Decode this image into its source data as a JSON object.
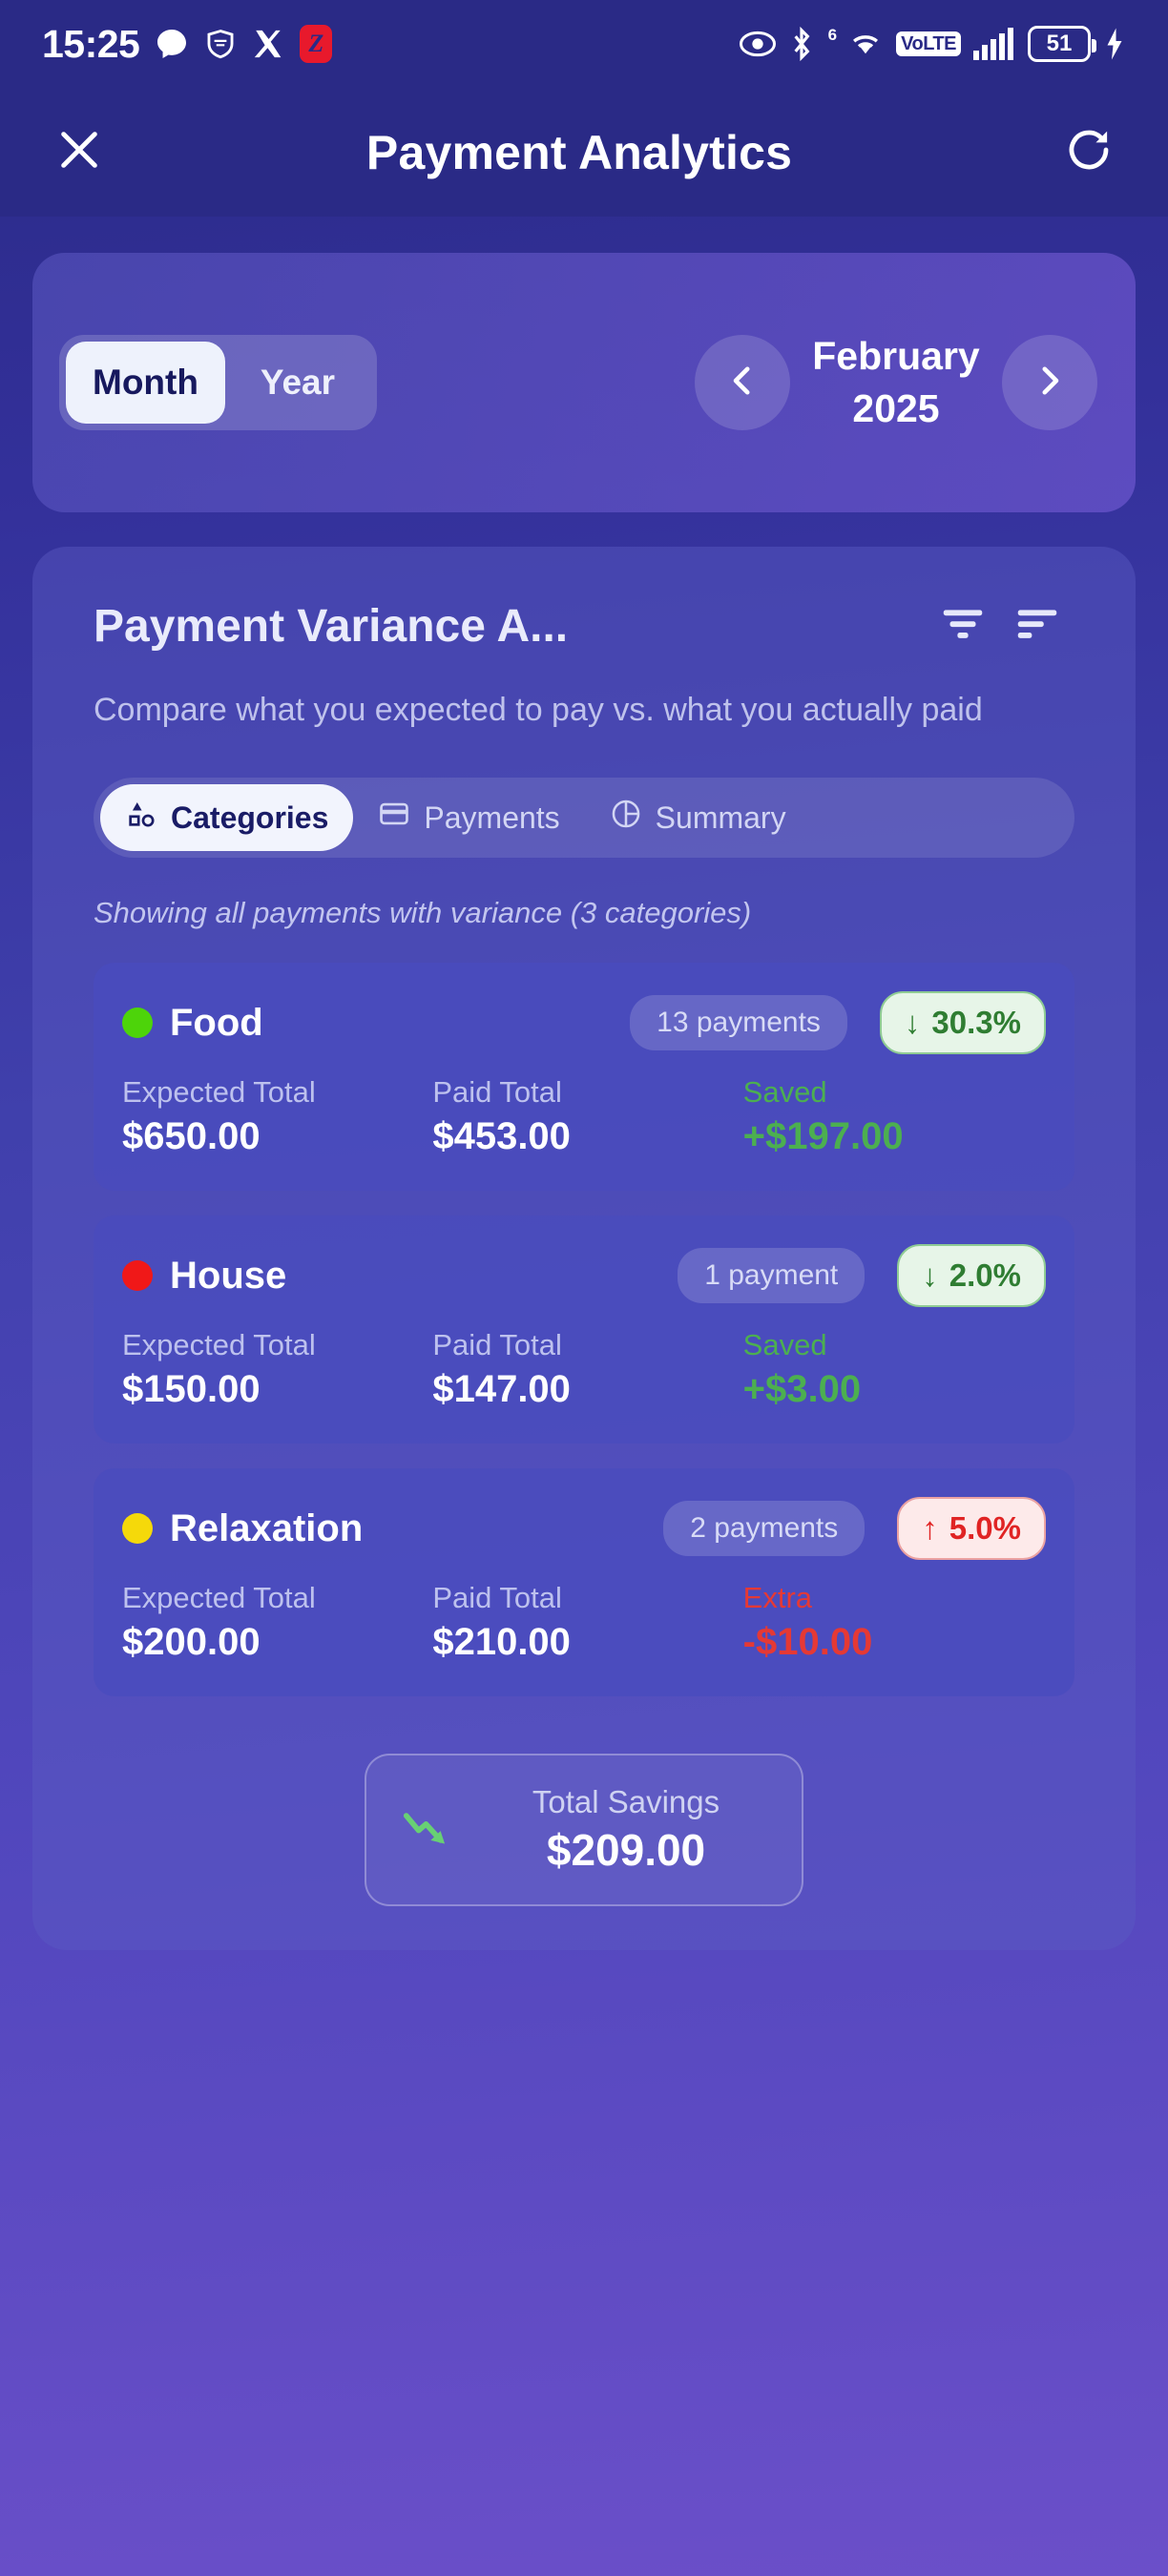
{
  "statusbar": {
    "time": "15:25",
    "left_icons": [
      "chat-bubble-icon",
      "shield-icon",
      "x-twitter-icon",
      "z-app-icon"
    ],
    "z_app_letter": "Z",
    "right_icons": [
      "eye-icon",
      "bluetooth-icon",
      "wifi-icon",
      "volte-icon",
      "signal-bars-icon",
      "battery-icon"
    ],
    "wifi_gen": "6",
    "volte_label": "VoLTE",
    "battery_level": "51"
  },
  "header": {
    "close_icon": "close-icon",
    "title": "Payment Analytics",
    "refresh_icon": "refresh-icon"
  },
  "period": {
    "segments": [
      {
        "label": "Month",
        "active": true
      },
      {
        "label": "Year",
        "active": false
      }
    ],
    "prev_icon": "chevron-left-icon",
    "next_icon": "chevron-right-icon",
    "current_period": "February 2025"
  },
  "panel": {
    "title": "Payment Variance A...",
    "filter_icon": "filter-icon",
    "sort_icon": "sort-icon",
    "subtitle": "Compare what you expected to pay vs. what you actually paid",
    "tabs": [
      {
        "label": "Categories",
        "icon": "shapes-icon",
        "active": true
      },
      {
        "label": "Payments",
        "icon": "credit-card-icon",
        "active": false
      },
      {
        "label": "Summary",
        "icon": "pie-chart-icon",
        "active": false
      }
    ],
    "showing_note": "Showing all payments with variance (3 categories)",
    "column_labels": {
      "expected": "Expected Total",
      "paid": "Paid Total"
    }
  },
  "chart_data": {
    "type": "bar",
    "title": "Payment Variance Analysis",
    "subtitle": "Compare what you expected to pay vs. what you actually paid",
    "categories": [
      "Food",
      "House",
      "Relaxation"
    ],
    "series": [
      {
        "name": "Expected Total",
        "values": [
          650.0,
          150.0,
          200.0
        ]
      },
      {
        "name": "Paid Total",
        "values": [
          453.0,
          147.0,
          210.0
        ]
      }
    ],
    "variance_pct": [
      -30.3,
      -2.0,
      5.0
    ],
    "variance_amount": [
      197.0,
      3.0,
      -10.0
    ],
    "payment_counts": [
      13,
      1,
      2
    ],
    "total_savings": 209.0,
    "currency": "$"
  },
  "categories": [
    {
      "name": "Food",
      "dot_color": "#4dd40a",
      "count_label": "13 payments",
      "variance_pct": "30.3%",
      "variance_dir": "down",
      "variance_arrow": "↓",
      "expected_label": "Expected Total",
      "expected_value": "$650.00",
      "paid_label": "Paid Total",
      "paid_value": "$453.00",
      "diff_label": "Saved",
      "diff_value": "+$197.00",
      "diff_tone": "pos"
    },
    {
      "name": "House",
      "dot_color": "#f01818",
      "count_label": "1 payment",
      "variance_pct": "2.0%",
      "variance_dir": "down",
      "variance_arrow": "↓",
      "expected_label": "Expected Total",
      "expected_value": "$150.00",
      "paid_label": "Paid Total",
      "paid_value": "$147.00",
      "diff_label": "Saved",
      "diff_value": "+$3.00",
      "diff_tone": "pos"
    },
    {
      "name": "Relaxation",
      "dot_color": "#f5d90a",
      "count_label": "2 payments",
      "variance_pct": "5.0%",
      "variance_dir": "up",
      "variance_arrow": "↑",
      "expected_label": "Expected Total",
      "expected_value": "$200.00",
      "paid_label": "Paid Total",
      "paid_value": "$210.00",
      "diff_label": "Extra",
      "diff_value": "-$10.00",
      "diff_tone": "neg"
    }
  ],
  "total": {
    "icon": "trend-down-icon",
    "label": "Total Savings",
    "value": "$209.00"
  },
  "colors": {
    "accent_green": "#4caf50",
    "accent_red": "#e53935",
    "brand_bg": "#2a2a86"
  }
}
